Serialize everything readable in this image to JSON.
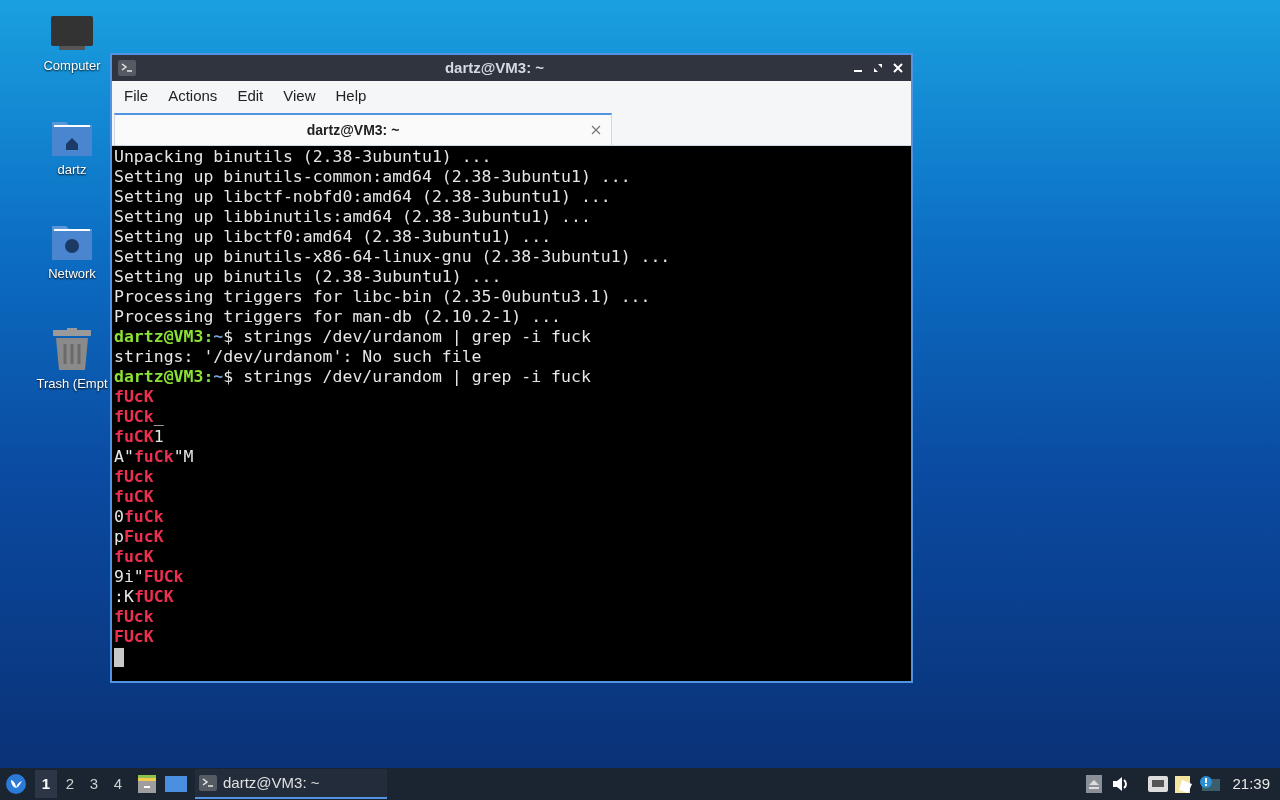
{
  "desktop_icons": [
    {
      "kind": "computer",
      "label": "Computer"
    },
    {
      "kind": "home",
      "label": "dartz"
    },
    {
      "kind": "network",
      "label": "Network"
    },
    {
      "kind": "trash",
      "label": "Trash (Empt"
    }
  ],
  "window": {
    "title": "dartz@VM3: ~",
    "menu": [
      "File",
      "Actions",
      "Edit",
      "View",
      "Help"
    ],
    "tabs": [
      {
        "label": "dartz@VM3: ~",
        "selected": true
      }
    ],
    "terminal": {
      "lines": [
        {
          "segments": [
            {
              "kind": "plain",
              "text": "Unpacking binutils (2.38-3ubuntu1) ..."
            }
          ]
        },
        {
          "segments": [
            {
              "kind": "plain",
              "text": "Setting up binutils-common:amd64 (2.38-3ubuntu1) ..."
            }
          ]
        },
        {
          "segments": [
            {
              "kind": "plain",
              "text": "Setting up libctf-nobfd0:amd64 (2.38-3ubuntu1) ..."
            }
          ]
        },
        {
          "segments": [
            {
              "kind": "plain",
              "text": "Setting up libbinutils:amd64 (2.38-3ubuntu1) ..."
            }
          ]
        },
        {
          "segments": [
            {
              "kind": "plain",
              "text": "Setting up libctf0:amd64 (2.38-3ubuntu1) ..."
            }
          ]
        },
        {
          "segments": [
            {
              "kind": "plain",
              "text": "Setting up binutils-x86-64-linux-gnu (2.38-3ubuntu1) ..."
            }
          ]
        },
        {
          "segments": [
            {
              "kind": "plain",
              "text": "Setting up binutils (2.38-3ubuntu1) ..."
            }
          ]
        },
        {
          "segments": [
            {
              "kind": "plain",
              "text": "Processing triggers for libc-bin (2.35-0ubuntu3.1) ..."
            }
          ]
        },
        {
          "segments": [
            {
              "kind": "plain",
              "text": "Processing triggers for man-db (2.10.2-1) ..."
            }
          ]
        },
        {
          "segments": [
            {
              "kind": "user",
              "text": "dartz@VM3"
            },
            {
              "kind": "user",
              "text": ":"
            },
            {
              "kind": "path",
              "text": "~"
            },
            {
              "kind": "plain",
              "text": "$ strings /dev/urdanom | grep -i fuck"
            }
          ]
        },
        {
          "segments": [
            {
              "kind": "plain",
              "text": "strings: '/dev/urdanom': No such file"
            }
          ]
        },
        {
          "segments": [
            {
              "kind": "user",
              "text": "dartz@VM3"
            },
            {
              "kind": "user",
              "text": ":"
            },
            {
              "kind": "path",
              "text": "~"
            },
            {
              "kind": "plain",
              "text": "$ strings /dev/urandom | grep -i fuck"
            }
          ]
        },
        {
          "segments": [
            {
              "kind": "match",
              "text": "fUcK"
            }
          ]
        },
        {
          "segments": [
            {
              "kind": "match",
              "text": "fUCk"
            },
            {
              "kind": "plain",
              "text": "_"
            }
          ]
        },
        {
          "segments": [
            {
              "kind": "match",
              "text": "fuCK"
            },
            {
              "kind": "plain",
              "text": "1"
            }
          ]
        },
        {
          "segments": [
            {
              "kind": "plain",
              "text": "A\""
            },
            {
              "kind": "match",
              "text": "fuCk"
            },
            {
              "kind": "plain",
              "text": "\"M"
            }
          ]
        },
        {
          "segments": [
            {
              "kind": "match",
              "text": "fUck"
            }
          ]
        },
        {
          "segments": [
            {
              "kind": "match",
              "text": "fuCK"
            }
          ]
        },
        {
          "segments": [
            {
              "kind": "plain",
              "text": "0"
            },
            {
              "kind": "match",
              "text": "fuCk"
            }
          ]
        },
        {
          "segments": [
            {
              "kind": "plain",
              "text": "p"
            },
            {
              "kind": "match",
              "text": "FucK"
            }
          ]
        },
        {
          "segments": [
            {
              "kind": "match",
              "text": "fucK"
            }
          ]
        },
        {
          "segments": [
            {
              "kind": "plain",
              "text": "9i\""
            },
            {
              "kind": "match",
              "text": "FUCk"
            }
          ]
        },
        {
          "segments": [
            {
              "kind": "plain",
              "text": ":K"
            },
            {
              "kind": "match",
              "text": "fUCK"
            }
          ]
        },
        {
          "segments": [
            {
              "kind": "match",
              "text": "fUck"
            }
          ]
        },
        {
          "segments": [
            {
              "kind": "match",
              "text": "FUcK"
            }
          ]
        }
      ]
    }
  },
  "taskbar": {
    "workspaces": [
      {
        "label": "1",
        "selected": true
      },
      {
        "label": "2",
        "selected": false
      },
      {
        "label": "3",
        "selected": false
      },
      {
        "label": "4",
        "selected": false
      }
    ],
    "tasks": [
      {
        "label": "dartz@VM3: ~",
        "selected": true
      }
    ],
    "clock": "21:39"
  }
}
